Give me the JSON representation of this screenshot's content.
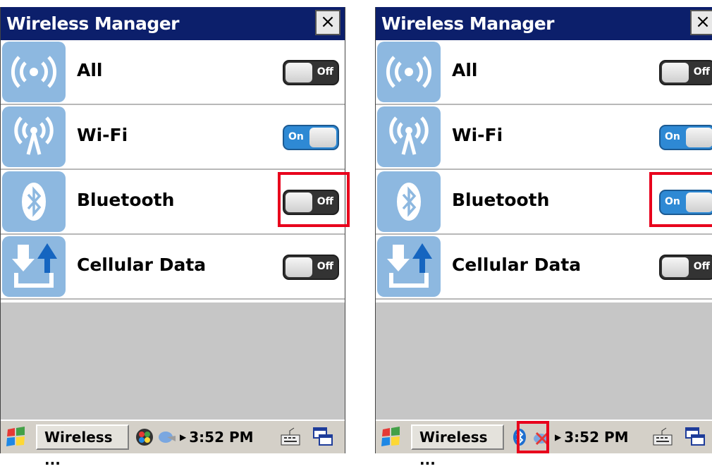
{
  "screens": [
    {
      "title": "Wireless Manager",
      "close_label": "×",
      "rows": [
        {
          "label": "All",
          "state": "off",
          "toggle_text": "Off"
        },
        {
          "label": "Wi-Fi",
          "state": "on",
          "toggle_text": "On"
        },
        {
          "label": "Bluetooth",
          "state": "off",
          "toggle_text": "Off"
        },
        {
          "label": "Cellular Data",
          "state": "off",
          "toggle_text": "Off"
        }
      ],
      "taskbar": {
        "task_label": "Wireless ...",
        "clock": "3:52 PM"
      }
    },
    {
      "title": "Wireless Manager",
      "close_label": "×",
      "rows": [
        {
          "label": "All",
          "state": "off",
          "toggle_text": "Off"
        },
        {
          "label": "Wi-Fi",
          "state": "on",
          "toggle_text": "On"
        },
        {
          "label": "Bluetooth",
          "state": "on",
          "toggle_text": "On"
        },
        {
          "label": "Cellular Data",
          "state": "off",
          "toggle_text": "Off"
        }
      ],
      "taskbar": {
        "task_label": "Wireless ...",
        "clock": "3:52 PM"
      }
    }
  ],
  "colors": {
    "titlebar": "#0c1f6b",
    "icon_tile": "#8db8e0",
    "toggle_on": "#2e89d4",
    "toggle_off": "#333333",
    "highlight": "#e8001c"
  }
}
